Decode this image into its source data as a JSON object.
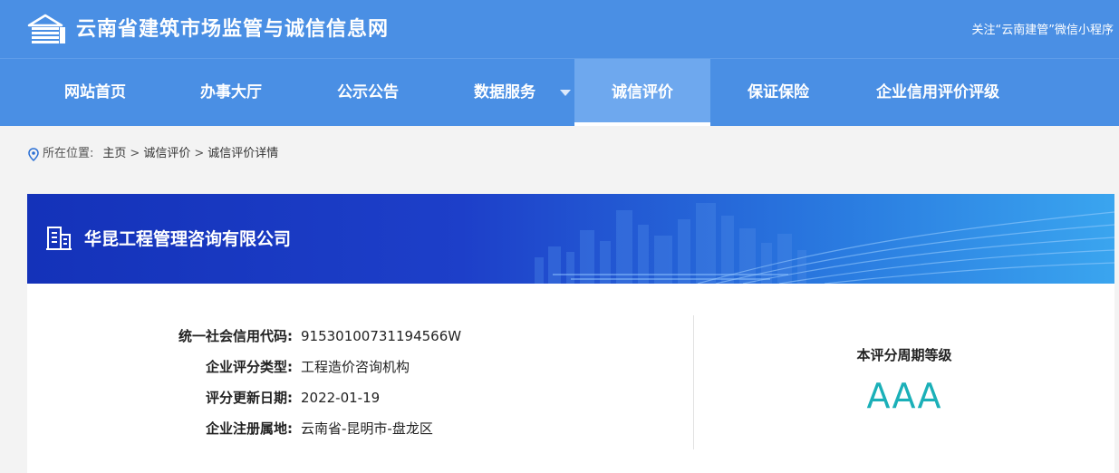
{
  "header": {
    "site_title": "云南省建筑市场监管与诚信信息网",
    "follow_text": "关注“云南建管”微信小程序",
    "logo_icon": "building-logo-icon"
  },
  "nav": {
    "items": [
      {
        "label": "网站首页"
      },
      {
        "label": "办事大厅"
      },
      {
        "label": "公示公告"
      },
      {
        "label": "数据服务"
      },
      {
        "label": "诚信评价"
      },
      {
        "label": "保证保险"
      },
      {
        "label": "企业信用评价评级"
      }
    ],
    "active_index": 4
  },
  "breadcrumb": {
    "prefix": "所在位置:",
    "items": [
      "主页",
      "诚信评价",
      "诚信评价详情"
    ],
    "separator": ">"
  },
  "company": {
    "name": "华昆工程管理咨询有限公司",
    "fields": [
      {
        "label": "统一社会信用代码:",
        "value": "91530100731194566W"
      },
      {
        "label": "企业评分类型:",
        "value": "工程造价咨询机构"
      },
      {
        "label": "评分更新日期:",
        "value": "2022-01-19"
      },
      {
        "label": "企业注册属地:",
        "value": "云南省-昆明市-盘龙区"
      }
    ]
  },
  "grade": {
    "title": "本评分周期等级",
    "value": "AAA"
  },
  "colors": {
    "header_blue": "#4a8fe4",
    "nav_active": "#6ea8ee",
    "banner_dark": "#1432b9",
    "banner_light": "#3aa5ef",
    "grade_teal": "#1bb0b8"
  }
}
